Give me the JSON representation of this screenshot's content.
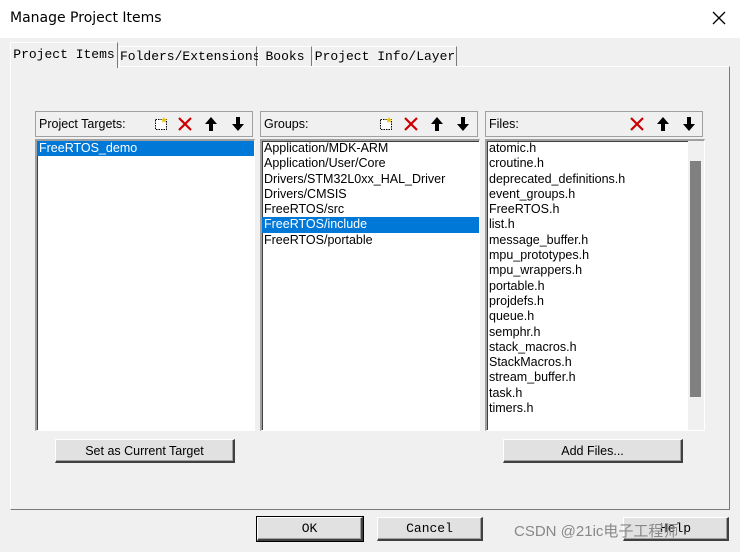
{
  "window": {
    "title": "Manage Project Items"
  },
  "tabs": [
    {
      "label": "Project Items",
      "active": true
    },
    {
      "label": "Folders/Extensions",
      "active": false
    },
    {
      "label": "Books",
      "active": false
    },
    {
      "label": "Project Info/Layer",
      "active": false
    }
  ],
  "targets": {
    "label": "Project Targets:",
    "items": [
      "FreeRTOS_demo"
    ],
    "selected": 0,
    "button": "Set as Current Target"
  },
  "groups": {
    "label": "Groups:",
    "items": [
      "Application/MDK-ARM",
      "Application/User/Core",
      "Drivers/STM32L0xx_HAL_Driver",
      "Drivers/CMSIS",
      "FreeRTOS/src",
      "FreeRTOS/include",
      "FreeRTOS/portable"
    ],
    "selected": 5
  },
  "files": {
    "label": "Files:",
    "items": [
      "atomic.h",
      "croutine.h",
      "deprecated_definitions.h",
      "event_groups.h",
      "FreeRTOS.h",
      "list.h",
      "message_buffer.h",
      "mpu_prototypes.h",
      "mpu_wrappers.h",
      "portable.h",
      "projdefs.h",
      "queue.h",
      "semphr.h",
      "stack_macros.h",
      "StackMacros.h",
      "stream_buffer.h",
      "task.h",
      "timers.h"
    ],
    "button": "Add Files..."
  },
  "footer": {
    "ok": "OK",
    "cancel": "Cancel",
    "help": "Help"
  },
  "watermark": "CSDN @21ic电子工程师",
  "icons": {
    "new": "new-item-icon",
    "delete": "delete-icon",
    "up": "move-up-icon",
    "down": "move-down-icon",
    "close": "close-icon"
  },
  "colors": {
    "selection": "#0078d7",
    "delete": "#cc0000"
  }
}
